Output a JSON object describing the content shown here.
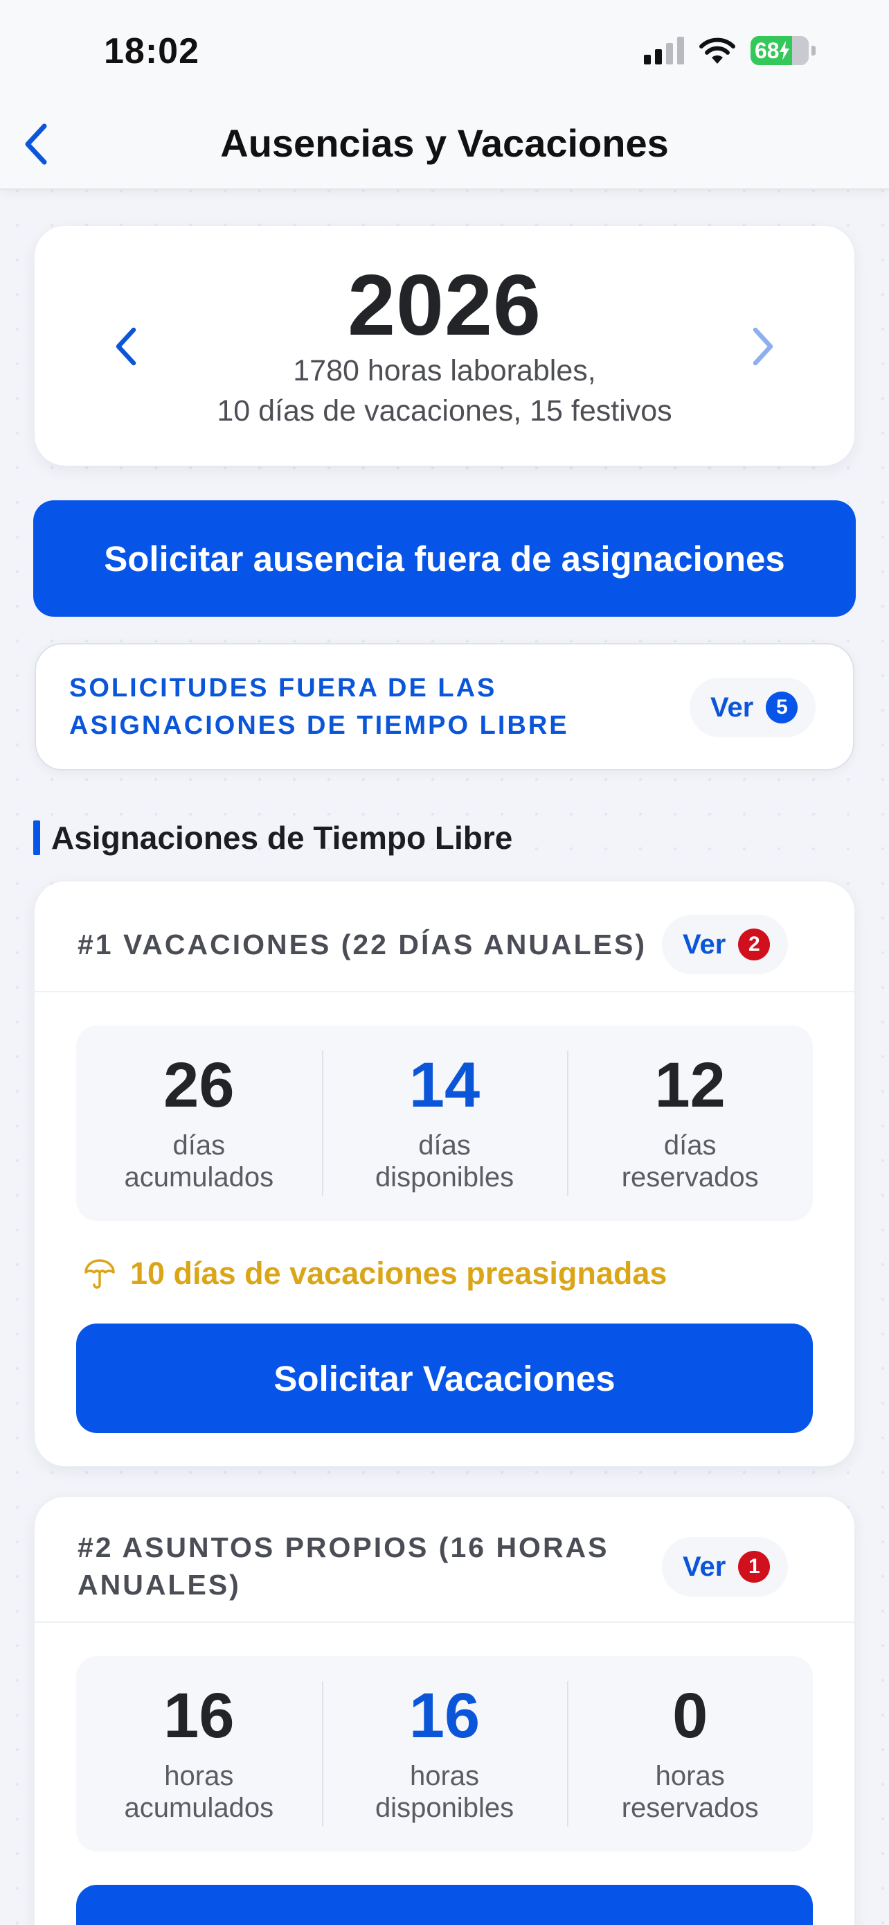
{
  "status_bar": {
    "time": "18:02",
    "battery": "68"
  },
  "nav": {
    "title": "Ausencias y Vacaciones"
  },
  "year_card": {
    "year": "2026",
    "summary_line1": "1780 horas laborables,",
    "summary_line2": "10 días de vacaciones, 15 festivos"
  },
  "buttons": {
    "request_outside": "Solicitar ausencia fuera de asignaciones"
  },
  "requests_outside": {
    "label_line1": "SOLICITUDES FUERA DE LAS",
    "label_line2": "ASIGNACIONES DE TIEMPO LIBRE",
    "ver_label": "Ver",
    "count": "5"
  },
  "section": {
    "title": "Asignaciones de Tiempo Libre"
  },
  "allocations": [
    {
      "title": "#1 VACACIONES (22 DÍAS ANUALES)",
      "ver_label": "Ver",
      "count": "2",
      "stats": [
        {
          "value": "26",
          "label_line1": "días",
          "label_line2": "acumulados"
        },
        {
          "value": "14",
          "label_line1": "días",
          "label_line2": "disponibles"
        },
        {
          "value": "12",
          "label_line1": "días",
          "label_line2": "reservados"
        }
      ],
      "preassigned": "10 días de vacaciones preasignadas",
      "action": "Solicitar Vacaciones"
    },
    {
      "title_line1": "#2 ASUNTOS PROPIOS (16 HORAS",
      "title_line2": "ANUALES)",
      "ver_label": "Ver",
      "count": "1",
      "stats": [
        {
          "value": "16",
          "label_line1": "horas",
          "label_line2": "acumulados"
        },
        {
          "value": "16",
          "label_line1": "horas",
          "label_line2": "disponibles"
        },
        {
          "value": "0",
          "label_line1": "horas",
          "label_line2": "reservados"
        }
      ]
    }
  ],
  "colors": {
    "primary": "#0655e8",
    "accent_text": "#0b56d8",
    "badge_red": "#d0101c",
    "warning": "#dba518",
    "battery": "#34c759"
  },
  "icons": {
    "back": "chevron-left-icon",
    "year_prev": "chevron-left-icon",
    "year_next": "chevron-right-icon",
    "preassigned": "umbrella-icon",
    "signal": "cellular-signal-icon",
    "wifi": "wifi-icon",
    "battery": "battery-charging-icon"
  }
}
